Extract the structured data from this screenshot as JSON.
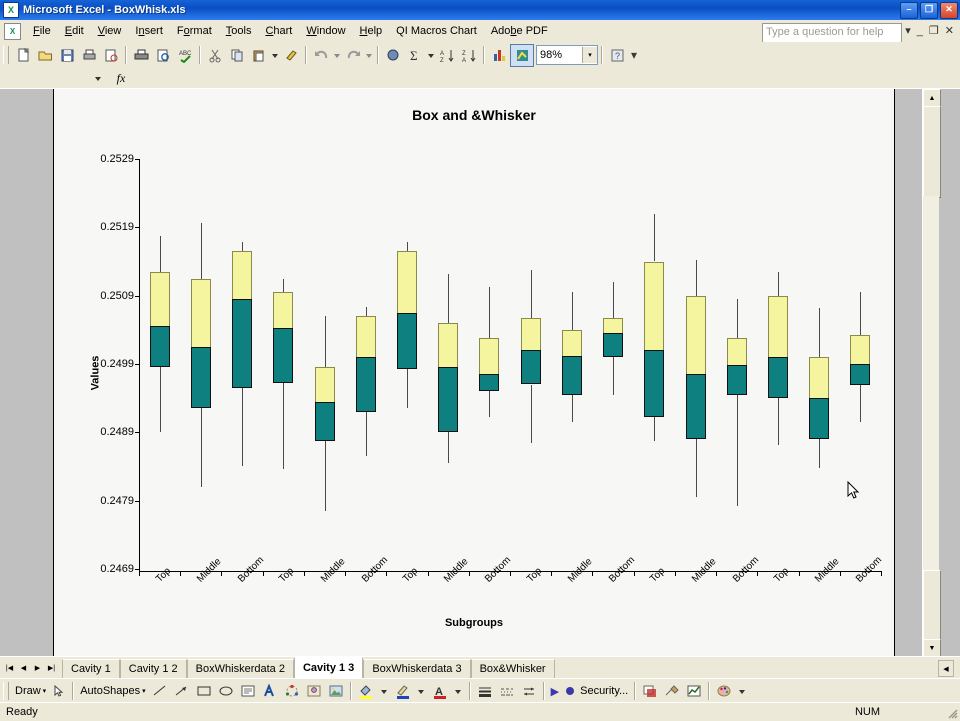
{
  "window": {
    "title": "Microsoft Excel - BoxWhisk.xls",
    "app_icon": "excel-icon",
    "minimize": "–",
    "maximize": "❐",
    "close": "✕"
  },
  "menu": {
    "items": [
      "File",
      "Edit",
      "View",
      "Insert",
      "Format",
      "Tools",
      "Chart",
      "Window",
      "Help",
      "QI Macros Chart",
      "Adobe PDF"
    ],
    "ask_placeholder": "Type a question for help",
    "doc_minimize": "_",
    "doc_restore": "❐",
    "doc_close": "✕",
    "dropdown": "▾"
  },
  "toolbar": {
    "zoom_value": "98%",
    "dropdown_arrow": "▾",
    "overflow": "▾",
    "buttons": [
      "new-icon",
      "open-icon",
      "save-icon",
      "print-icon",
      "print-preview-icon",
      "print2-icon",
      "preview-icon",
      "spelling-icon",
      "cut-icon",
      "copy-icon",
      "paste-icon",
      "format-painter-icon",
      "undo-icon",
      "redo-icon",
      "hyperlink-icon",
      "autosum-icon",
      "sort-asc-icon",
      "sort-desc-icon",
      "chart-wizard-icon",
      "qimacros-icon",
      "help-icon"
    ]
  },
  "formula_bar": {
    "name_box_value": "",
    "fx_label": "fx",
    "content": ""
  },
  "chart_data": {
    "type": "box",
    "title": "Box and &Whisker",
    "xlabel": "Subgroups",
    "ylabel": "Values",
    "ylim": [
      0.2469,
      0.2529
    ],
    "yticks": [
      "0.2469",
      "0.2479",
      "0.2489",
      "0.2499",
      "0.2509",
      "0.2519",
      "0.2529"
    ],
    "grid": false,
    "legend": "none",
    "box_fill_lower": "#0f8080",
    "box_fill_upper": "#f5f5a0",
    "categories": [
      "Top",
      "Middle",
      "Bottom",
      "Top",
      "Middle",
      "Bottom",
      "Top",
      "Middle",
      "Bottom",
      "Top",
      "Middle",
      "Bottom",
      "Top",
      "Middle",
      "Bottom",
      "Top",
      "Middle",
      "Bottom"
    ],
    "boxes": [
      {
        "label": "Top",
        "min": 0.2489,
        "q1": 0.24985,
        "median": 0.25045,
        "q3": 0.25125,
        "max": 0.25178
      },
      {
        "label": "Middle",
        "min": 0.2481,
        "q1": 0.24925,
        "median": 0.25015,
        "q3": 0.25115,
        "max": 0.25197
      },
      {
        "label": "Bottom",
        "min": 0.2484,
        "q1": 0.24955,
        "median": 0.25085,
        "q3": 0.25155,
        "max": 0.25168
      },
      {
        "label": "Top",
        "min": 0.24837,
        "q1": 0.24962,
        "median": 0.25042,
        "q3": 0.25095,
        "max": 0.25114
      },
      {
        "label": "Middle",
        "min": 0.24775,
        "q1": 0.24877,
        "median": 0.24935,
        "q3": 0.24985,
        "max": 0.2506
      },
      {
        "label": "Bottom",
        "min": 0.24856,
        "q1": 0.2492,
        "median": 0.25,
        "q3": 0.2506,
        "max": 0.25074
      },
      {
        "label": "Top",
        "min": 0.24925,
        "q1": 0.24982,
        "median": 0.25065,
        "q3": 0.25155,
        "max": 0.25168
      },
      {
        "label": "Middle",
        "min": 0.24845,
        "q1": 0.2489,
        "median": 0.24985,
        "q3": 0.2505,
        "max": 0.25122
      },
      {
        "label": "Bottom",
        "min": 0.24912,
        "q1": 0.2495,
        "median": 0.24975,
        "q3": 0.25028,
        "max": 0.25103
      },
      {
        "label": "Top",
        "min": 0.24875,
        "q1": 0.2496,
        "median": 0.2501,
        "q3": 0.25058,
        "max": 0.25128
      },
      {
        "label": "Middle",
        "min": 0.24905,
        "q1": 0.24945,
        "median": 0.25002,
        "q3": 0.2504,
        "max": 0.25095
      },
      {
        "label": "Bottom",
        "min": 0.24945,
        "q1": 0.25,
        "median": 0.25035,
        "q3": 0.25058,
        "max": 0.2511
      },
      {
        "label": "Top",
        "min": 0.24878,
        "q1": 0.24912,
        "median": 0.2501,
        "q3": 0.2514,
        "max": 0.2521
      },
      {
        "label": "Middle",
        "min": 0.24795,
        "q1": 0.2488,
        "median": 0.24975,
        "q3": 0.2509,
        "max": 0.25142
      },
      {
        "label": "Bottom",
        "min": 0.24782,
        "q1": 0.24945,
        "median": 0.24988,
        "q3": 0.25028,
        "max": 0.25085
      },
      {
        "label": "Top",
        "min": 0.24872,
        "q1": 0.2494,
        "median": 0.25,
        "q3": 0.2509,
        "max": 0.25125
      },
      {
        "label": "Middle",
        "min": 0.24838,
        "q1": 0.2488,
        "median": 0.2494,
        "q3": 0.25,
        "max": 0.25072
      },
      {
        "label": "Bottom",
        "min": 0.24905,
        "q1": 0.2496,
        "median": 0.2499,
        "q3": 0.25032,
        "max": 0.25095
      }
    ]
  },
  "sheet_tabs": {
    "nav_first": "|◀",
    "nav_prev": "◀",
    "nav_next": "▶",
    "nav_last": "▶|",
    "scroll_right": "◀",
    "items": [
      {
        "label": "Cavity 1",
        "active": false
      },
      {
        "label": "Cavity 1 2",
        "active": false
      },
      {
        "label": "BoxWhiskerdata 2",
        "active": false
      },
      {
        "label": "Cavity 1 3",
        "active": true
      },
      {
        "label": "BoxWhiskerdata 3",
        "active": false
      },
      {
        "label": "Box&Whisker",
        "active": false
      }
    ]
  },
  "drawing_toolbar": {
    "draw_label": "Draw",
    "autoshapes_label": "AutoShapes",
    "security_label": "Security...",
    "dropdown": "▾",
    "arrow_right": "▶",
    "items": [
      "select-objects-icon",
      "line-icon",
      "arrow-icon",
      "rectangle-icon",
      "oval-icon",
      "textbox-icon",
      "wordart-icon",
      "diagram-icon",
      "clipart-icon",
      "picture-icon",
      "fill-color-icon",
      "line-color-icon",
      "font-color-icon",
      "line-style-icon",
      "dash-style-icon",
      "arrow-style-icon",
      "shadow-icon",
      "3d-icon"
    ]
  },
  "status_bar": {
    "message": "Ready",
    "num_lock": "NUM"
  }
}
